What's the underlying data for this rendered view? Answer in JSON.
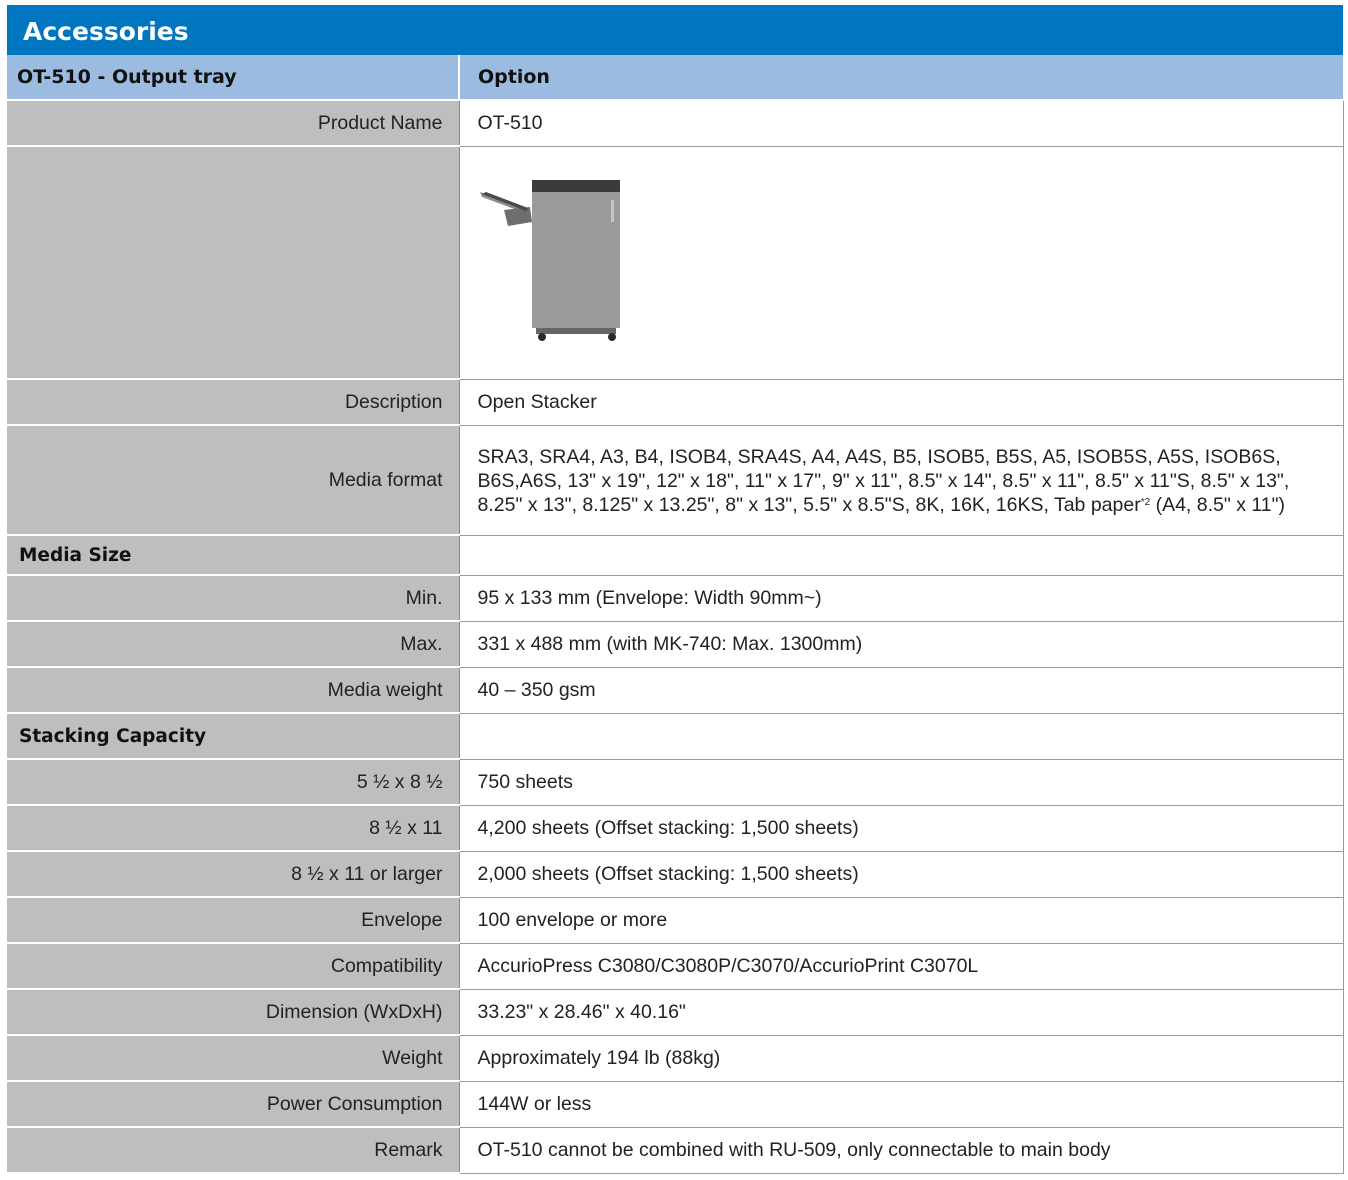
{
  "title": "Accessories",
  "header": {
    "left": "OT-510 - Output tray",
    "right": "Option"
  },
  "product_name": {
    "label": "Product Name",
    "value": "OT-510"
  },
  "image_alt": "OT-510 open stacker product image",
  "description": {
    "label": "Description",
    "value": "Open Stacker"
  },
  "media_format": {
    "label": "Media format",
    "line1": "SRA3, SRA4, A3, B4, ISOB4, SRA4S, A4, A4S, B5, ISOB5, B5S, A5, ISOB5S, A5S, ISOB6S,",
    "line2": "B6S,A6S, 13\" x 19\", 12\" x 18\", 11\" x 17\", 9\" x 11\", 8.5\" x 14\", 8.5\" x 11\", 8.5\" x 11\"S, 8.5\" x 13\",",
    "line3a": "8.25\" x 13\", 8.125\" x 13.25\", 8\" x 13\", 5.5\" x 8.5\"S, 8K, 16K, 16KS, Tab paper",
    "line3sup": "*2",
    "line3b": " (A4, 8.5\" x 11\")"
  },
  "media_size": {
    "section": "Media Size",
    "min_label": "Min.",
    "min_value": "95 x 133 mm (Envelope: Width 90mm~)",
    "max_label": "Max.",
    "max_value": "331 x 488 mm (with MK-740: Max. 1300mm)"
  },
  "media_weight": {
    "label": "Media weight",
    "value": "40 – 350 gsm"
  },
  "stacking": {
    "section": "Stacking Capacity",
    "rows": [
      {
        "label": "5 ½ x 8 ½",
        "value": "750 sheets"
      },
      {
        "label": "8 ½ x 11",
        "value": "4,200 sheets (Offset stacking: 1,500 sheets)"
      },
      {
        "label": "8 ½ x 11 or larger",
        "value": "2,000 sheets (Offset stacking: 1,500 sheets)"
      },
      {
        "label": "Envelope",
        "value": "100 envelope or more"
      }
    ]
  },
  "compatibility": {
    "label": "Compatibility",
    "value": "AccurioPress C3080/C3080P/C3070/AccurioPrint C3070L"
  },
  "dimension": {
    "label": "Dimension (WxDxH)",
    "value": "33.23\" x 28.46\" x 40.16\""
  },
  "weight": {
    "label": "Weight",
    "value": "Approximately 194 lb (88kg)"
  },
  "power": {
    "label": "Power Consumption",
    "value": "144W or less"
  },
  "remark": {
    "label": "Remark",
    "value": "OT-510 cannot be combined with RU-509, only connectable to main body"
  }
}
